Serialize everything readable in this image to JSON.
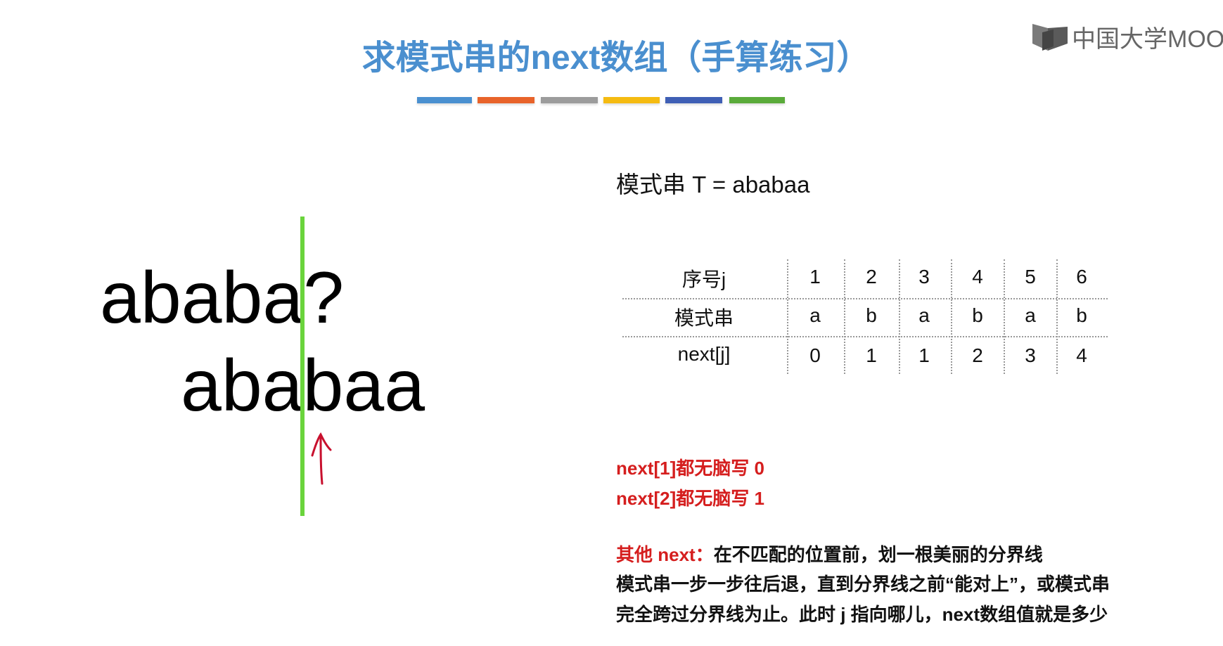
{
  "slide": {
    "title": "求模式串的next数组（手算练习）",
    "color_bars": [
      "#4a90d0",
      "#e8632a",
      "#9c9c9c",
      "#f5bb11",
      "#3f5fb5",
      "#5aab3a"
    ],
    "logo_text": "中国大学MOOC",
    "pattern_line": "模式串 T = ababaa"
  },
  "table": {
    "row_labels": [
      "序号j",
      "模式串",
      "next[j]"
    ],
    "j": [
      "1",
      "2",
      "3",
      "4",
      "5",
      "6"
    ],
    "pattern": [
      "a",
      "b",
      "a",
      "b",
      "a",
      "b"
    ],
    "next": [
      "0",
      "1",
      "1",
      "2",
      "3",
      "4"
    ]
  },
  "illustration": {
    "main_string": "ababa?",
    "pattern_shifted": "ababaa",
    "divider_color": "#6ad43c",
    "arrow_color": "#c8102e"
  },
  "rules": {
    "rule1": "next[1]都无脑写 0",
    "rule2": "next[2]都无脑写 1",
    "other_label": "其他 next：",
    "other_line1": "在不匹配的位置前，划一根美丽的分界线",
    "other_line2": "模式串一步一步往后退，直到分界线之前“能对上”，或模式串",
    "other_line3": "完全跨过分界线为止。此时 j 指向哪儿，next数组值就是多少"
  }
}
